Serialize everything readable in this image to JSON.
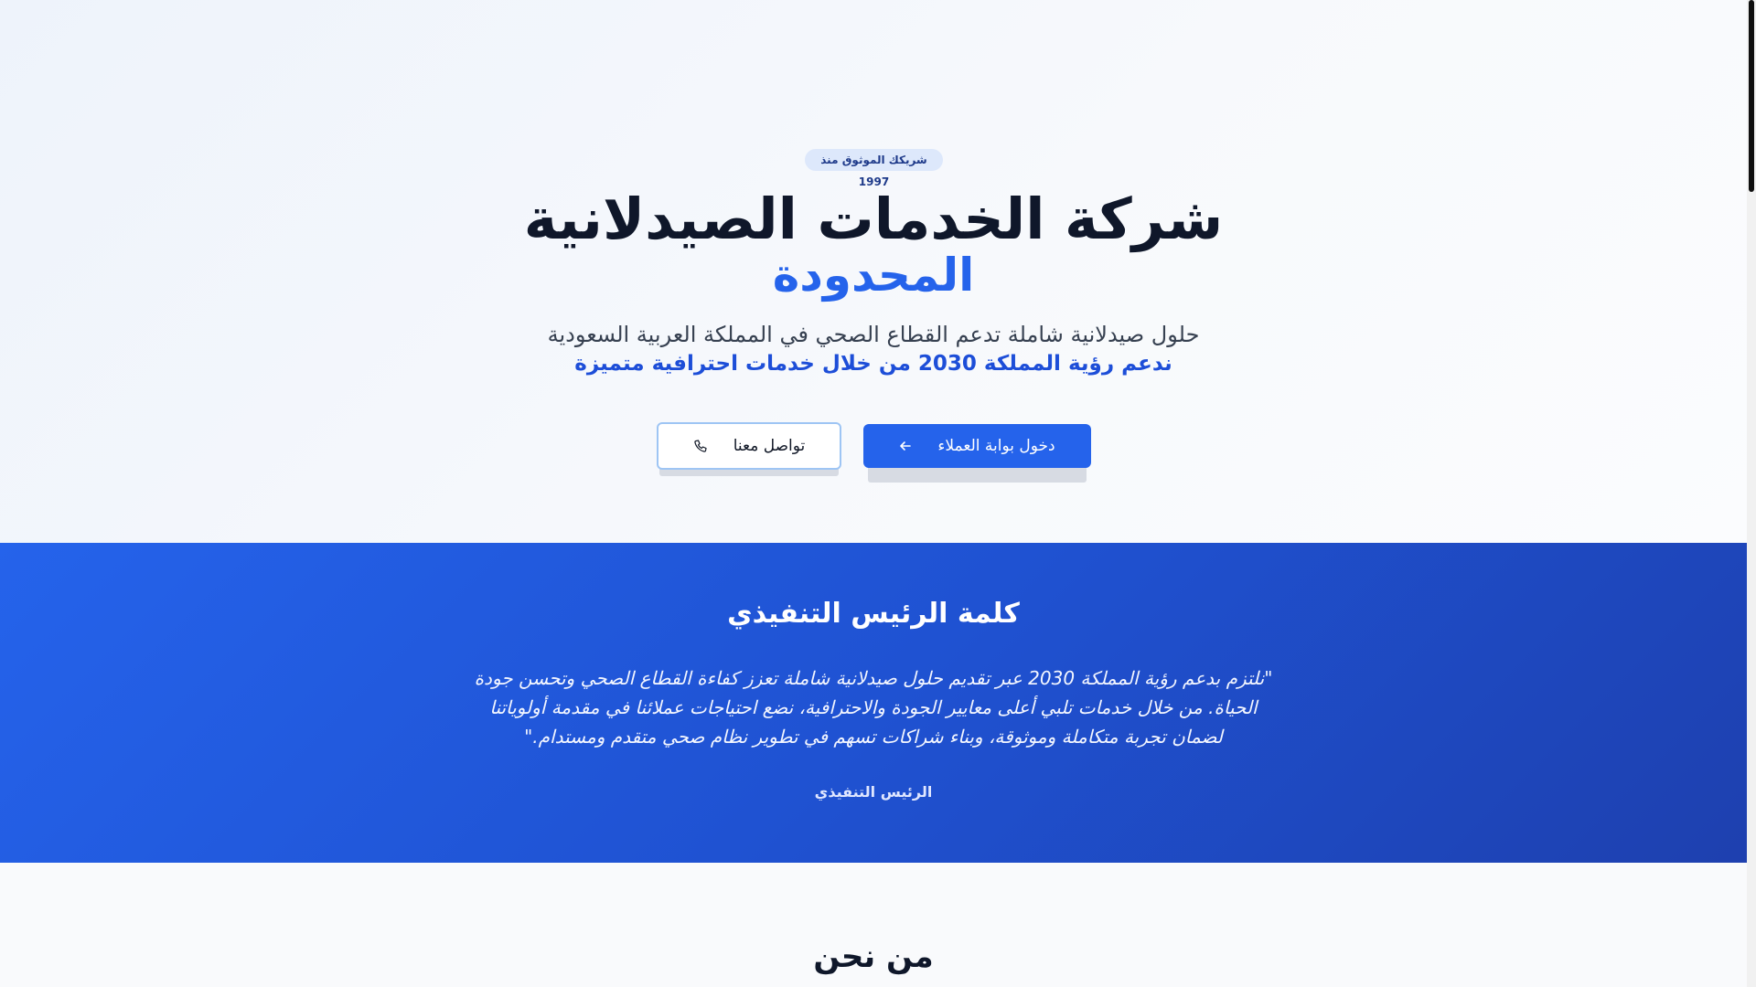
{
  "hero": {
    "badge": "شريكك الموثوق منذ 1997",
    "title_line1": "شركة الخدمات الصيدلانية",
    "title_line2": "المحدودة",
    "subtitle": "حلول صيدلانية شاملة تدعم القطاع الصحي في المملكة العربية السعودية",
    "tagline": "ندعم رؤية المملكة 2030 من خلال خدمات احترافية متميزة",
    "primary_button": {
      "label": "دخول بوابة العملاء",
      "icon": "arrow-left-icon"
    },
    "secondary_button": {
      "label": "تواصل معنا",
      "icon": "phone-icon"
    }
  },
  "ceo": {
    "title": "كلمة الرئيس التنفيذي",
    "quote": "\"نلتزم بدعم رؤية المملكة 2030 عبر تقديم حلول صيدلانية شاملة تعزز كفاءة القطاع الصحي وتحسن جودة الحياة. من خلال خدمات تلبي أعلى معايير الجودة والاحترافية، نضع احتياجات عملائنا في مقدمة أولوياتنا لضمان تجربة متكاملة وموثوقة، وبناء شراكات تسهم في تطوير نظام صحي متقدم ومستدام.\"",
    "role": "الرئيس التنفيذي"
  },
  "about": {
    "title": "من نحن"
  },
  "colors": {
    "primary": "#2563eb",
    "primary_dark": "#1e40af",
    "text_dark": "#0f172a",
    "badge_bg": "#dde8fb"
  }
}
